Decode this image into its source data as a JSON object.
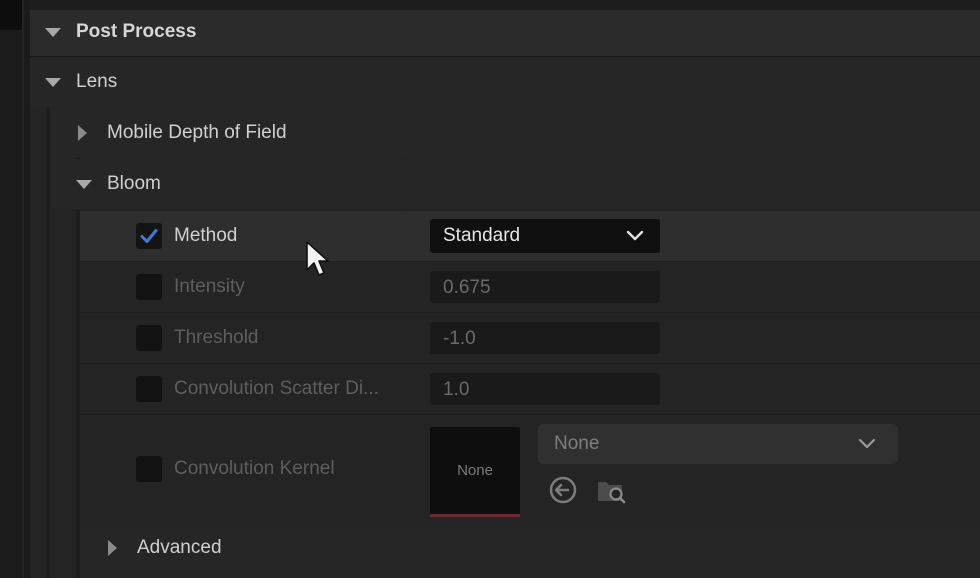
{
  "categories": {
    "post_process": "Post Process",
    "lens": "Lens",
    "mobile_dof": "Mobile Depth of Field",
    "bloom": "Bloom",
    "advanced": "Advanced"
  },
  "properties": {
    "method": {
      "label": "Method",
      "checked": true,
      "value": "Standard"
    },
    "intensity": {
      "label": "Intensity",
      "checked": false,
      "value": "0.675"
    },
    "threshold": {
      "label": "Threshold",
      "checked": false,
      "value": "-1.0"
    },
    "scatter": {
      "label": "Convolution Scatter Di...",
      "checked": false,
      "value": "1.0"
    },
    "kernel": {
      "label": "Convolution Kernel",
      "checked": false,
      "thumbnail": "None",
      "asset": "None"
    }
  },
  "icons": {
    "reset": "reset-to-default-icon",
    "browse": "browse-folder-icon",
    "dropdown": "chevron-down-icon",
    "expand": "triangle-arrow-icon",
    "cursor": "mouse-pointer-icon"
  },
  "colors": {
    "panel_bg": "#242424",
    "checkbox_check": "#3d7bd6",
    "thumbnail_underline": "#6a2a30"
  }
}
